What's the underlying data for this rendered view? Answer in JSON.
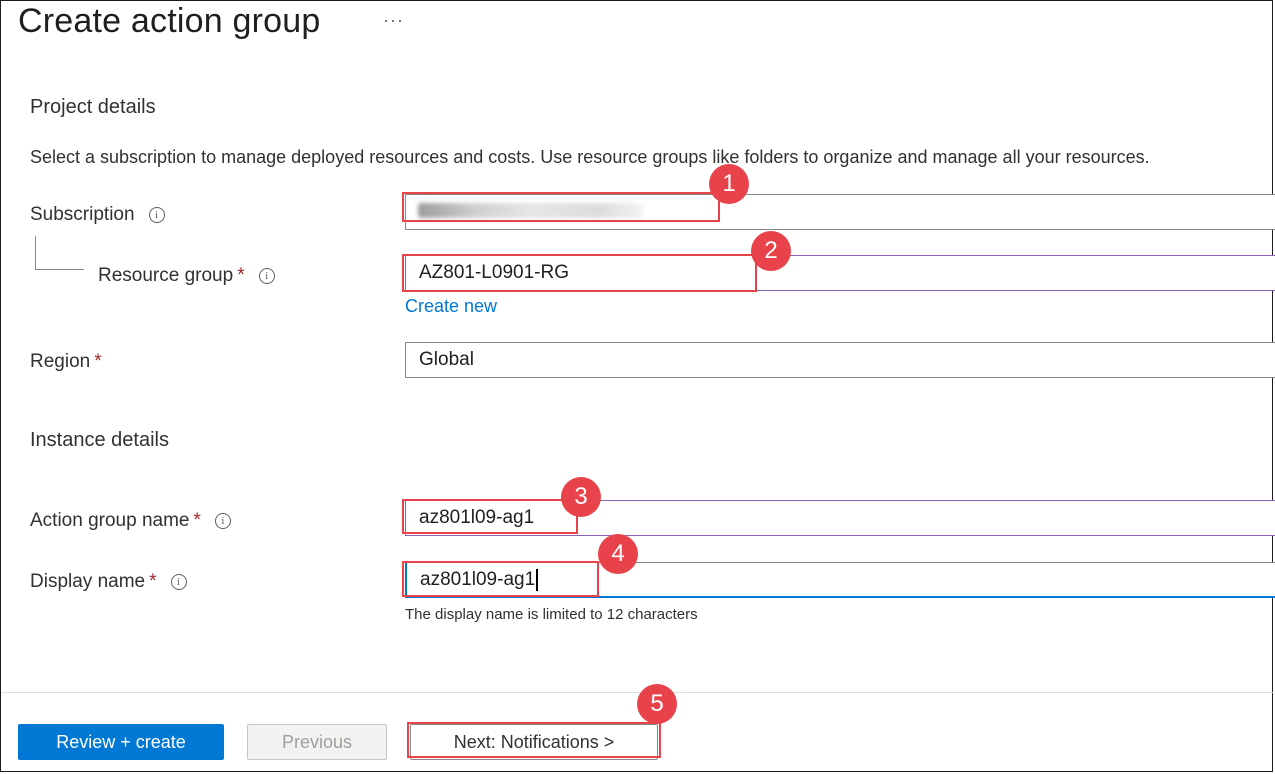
{
  "header": {
    "title": "Create action group",
    "more_label": "···"
  },
  "project": {
    "heading": "Project details",
    "description": "Select a subscription to manage deployed resources and costs. Use resource groups like folders to organize and manage all your resources.",
    "subscription_label": "Subscription",
    "resource_group_label": "Resource group",
    "resource_group_value": "AZ801-L0901-RG",
    "create_new_label": "Create new",
    "region_label": "Region",
    "region_value": "Global"
  },
  "instance": {
    "heading": "Instance details",
    "action_group_name_label": "Action group name",
    "action_group_name_value": "az801l09-ag1",
    "display_name_label": "Display name",
    "display_name_value": "az801l09-ag1",
    "display_name_hint": "The display name is limited to 12 characters"
  },
  "common": {
    "required_mark": "*",
    "info_glyph": "i"
  },
  "footer": {
    "review_create_label": "Review + create",
    "previous_label": "Previous",
    "next_label": "Next: Notifications >"
  },
  "annotations": {
    "step1": "1",
    "step2": "2",
    "step3": "3",
    "step4": "4",
    "step5": "5"
  },
  "colors": {
    "accent": "#0078d4",
    "highlight": "#e8434a",
    "required": "#a4262c"
  }
}
